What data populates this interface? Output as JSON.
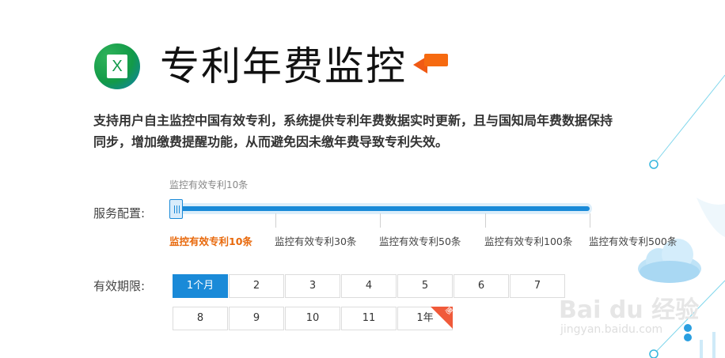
{
  "header": {
    "logo_letter": "X",
    "title": "专利年费监控"
  },
  "description": "支持用户自主监控中国有效专利，系统提供专利年费数据实时更新，且与国知局年费数据保持同步，增加缴费提醒功能，从而避免因未缴年费导致专利失效。",
  "service": {
    "label": "服务配置:",
    "current_hint": "监控有效专利10条",
    "selected_index": 0,
    "options": [
      "监控有效专利10条",
      "监控有效专利30条",
      "监控有效专利50条",
      "监控有效专利100条",
      "监控有效专利500条"
    ],
    "accent_color": "#1a8ad8",
    "active_color": "#e8690c"
  },
  "period": {
    "label": "有效期限:",
    "row1": [
      "1个月",
      "2",
      "3",
      "4",
      "5",
      "6",
      "7"
    ],
    "row2": [
      "8",
      "9",
      "10",
      "11",
      "1年"
    ],
    "selected": "1个月",
    "badge_text": "惠"
  },
  "watermark": {
    "brand": "Bai du 经验",
    "url": "jingyan.baidu.com"
  }
}
